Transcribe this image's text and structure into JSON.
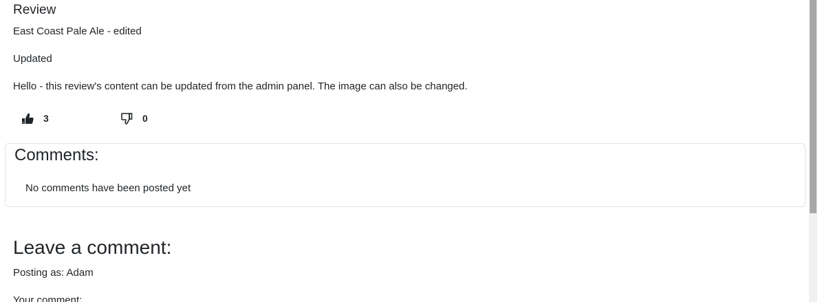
{
  "review": {
    "title": "Review",
    "subtitle": "East Coast Pale Ale - edited",
    "heading": "Updated",
    "body": "Hello - this review's content can be updated from the admin panel. The image can also be changed.",
    "likes": "3",
    "dislikes": "0",
    "like_icon": "thumbs-up-icon",
    "dislike_icon": "thumbs-down-icon"
  },
  "comments": {
    "title": "Comments:",
    "empty_message": "No comments have been posted yet"
  },
  "leave_comment": {
    "title": "Leave a comment:",
    "posting_as": "Posting as: Adam",
    "field_label": "Your comment:"
  },
  "colors": {
    "text": "#212529",
    "card_border": "#dee2e6",
    "scrollbar_track": "#f1f1f1",
    "scrollbar_thumb": "#a8a8a8"
  }
}
